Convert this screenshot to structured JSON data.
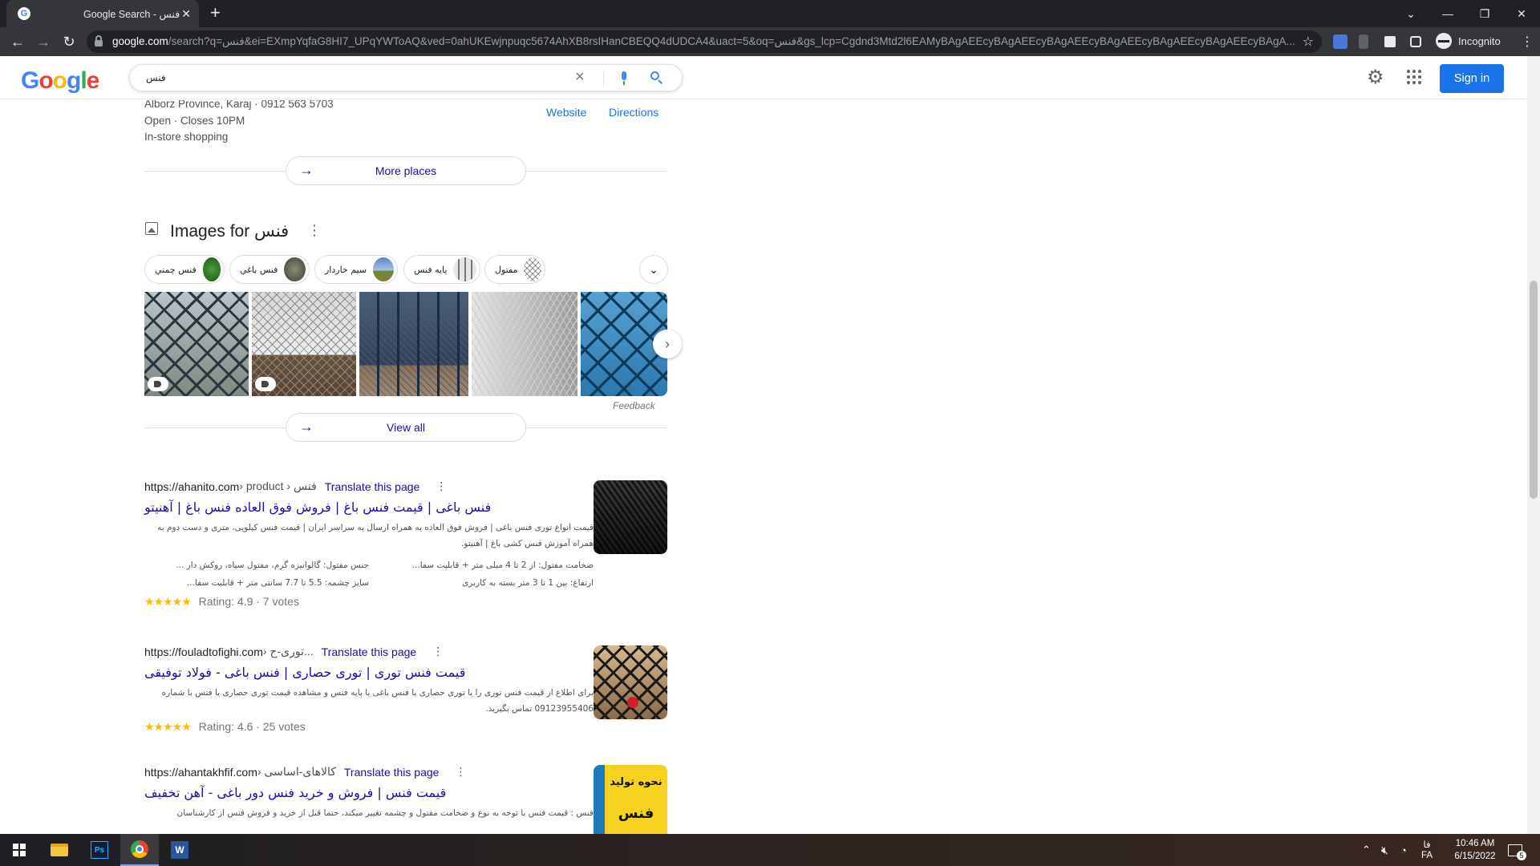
{
  "browser": {
    "tab_title": "Google Search - فنس",
    "url_host": "google.com",
    "url_rest": "/search?q=فنس&ei=EXmpYqfaG8HI7_UPqYWToAQ&ved=0ahUKEwjnpuqc5674AhXB8rsIHanCBEQQ4dUDCA4&uact=5&oq=فنس&gs_lcp=Cgdnd3Mtd2l6EAMyBAgAEEcyBAgAEEcyBAgAEEcyBAgAEEcyBAgAEEcyBAgAEEcyBAgA...",
    "profile_label": "Incognito"
  },
  "header": {
    "logo": [
      "G",
      "o",
      "o",
      "g",
      "l",
      "e"
    ],
    "logo_colors": [
      "#4285f4",
      "#ea4335",
      "#fbbc05",
      "#4285f4",
      "#34a853",
      "#ea4335"
    ],
    "search_value": "فنس",
    "signin_label": "Sign in"
  },
  "local": {
    "address": "Alborz Province, Karaj · 0912 563 5703",
    "hours": "Open · Closes 10PM",
    "service": "In-store shopping",
    "website_label": "Website",
    "directions_label": "Directions",
    "more_places_label": "More places"
  },
  "images": {
    "heading": "Images for فنس",
    "chips": [
      "فنس چمني",
      "فنس باغي",
      "سیم خاردار",
      "پایه فنس",
      "مفتول"
    ],
    "feedback": "Feedback",
    "view_all": "View all"
  },
  "results": [
    {
      "site": "https://ahanito.com",
      "path": " › product › فنس",
      "translate": "Translate this page",
      "title": "فنس باغی | قیمت فنس باغ | فروش فوق العاده فنس باغ | آهنیتو",
      "snippet": "قیمت انواع توری فنس باغی | فروش فوق العاده به همراه ارسال به سراسر ایران | قیمت فنس کیلویی، متری و دست دوم به همراه آموزش فنس کشی باغ | آهنیتو.",
      "facts": [
        "ضخامت مفتول: از 2 تا 4 میلی متر + قابلیت سفا...",
        "جنس مفتول: گالوانیزه گرم، مفتول سیاه، روکش دار ...",
        "ارتفاع: بین 1 تا 3 متر بسته به کاربری",
        "سایز چشمه: 5.5 تا 7.7 سانتی متر + قابلیت سفا..."
      ],
      "stars": "★★★★★",
      "rating": "Rating: 4.9 · 7 votes"
    },
    {
      "site": "https://fouladtofighi.com",
      "path": " › توری-ح...",
      "translate": "Translate this page",
      "title": "قیمت فنس توری | توری حصاری | فنس باغی - فولاد توفیقی",
      "snippet": "برای اطلاع از قیمت فنس توری را یا توری حصاری یا فنس باغی یا پایه فنس و مشاهده قیمت توری حصاری یا فنس با شماره 09123955406 تماس بگیرید.",
      "stars": "★★★★★",
      "rating": "Rating: 4.6 · 25 votes"
    },
    {
      "site": "https://ahantakhfif.com",
      "path": " › کالاهای-اساسی",
      "translate": "Translate this page",
      "title": "قیمت فنس | فروش و خرید فنس دور باغی - آهن تخفیف",
      "snippet": "فنس : قیمت فنس با توجه به نوع و ضخامت مفتول و چشمه تغییر میکند، حتما قبل از خرید و فروش فنس از کارشناسان",
      "thumb_text_1": "نحوه تولید",
      "thumb_text_2": "فنس"
    }
  ],
  "taskbar": {
    "lang": "FA",
    "lang_fa": "فا",
    "time": "10:46 AM",
    "date": "6/15/2022",
    "notif_count": "5"
  }
}
